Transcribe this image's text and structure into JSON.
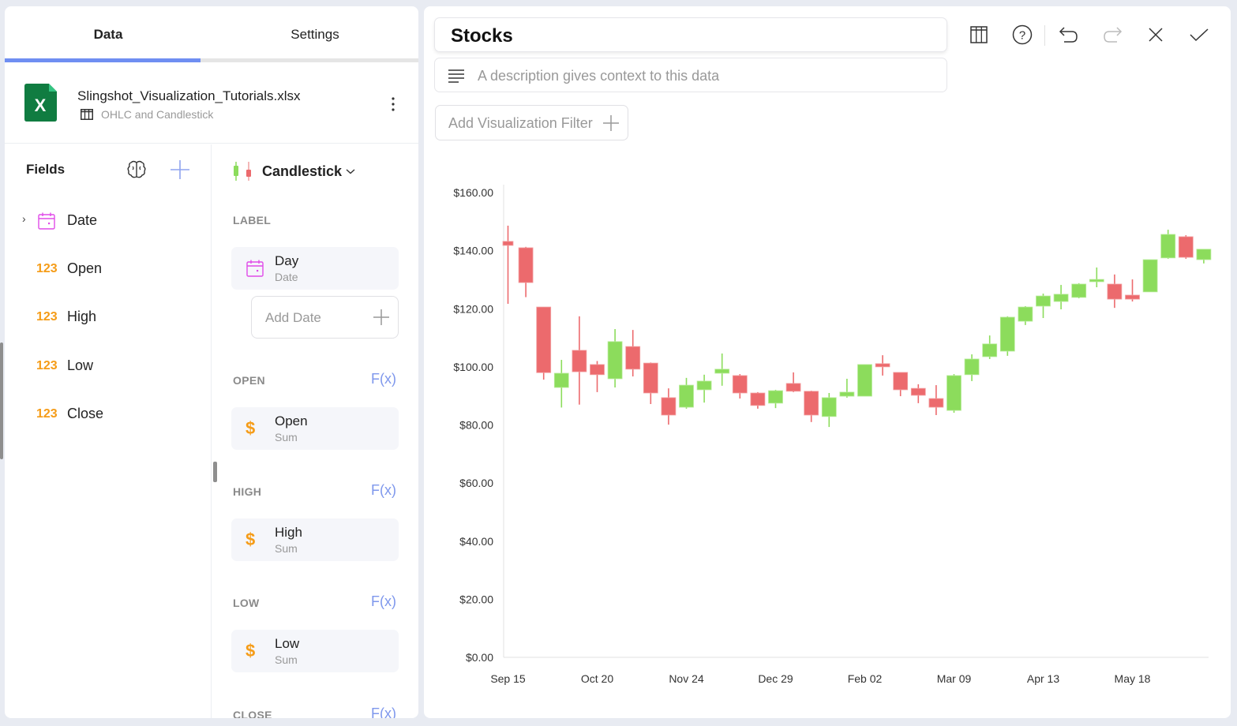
{
  "tabs": [
    {
      "label": "Data",
      "active": true
    },
    {
      "label": "Settings",
      "active": false
    }
  ],
  "source": {
    "file_name": "Slingshot_Visualization_Tutorials.xlsx",
    "sheet_name": "OHLC and Candlestick",
    "file_icon": "excel-icon",
    "menu_icon": "more-vertical-icon"
  },
  "fields": {
    "title": "Fields",
    "items": [
      {
        "label": "Date",
        "type": "date",
        "icon": "calendar-icon",
        "expandable": true
      },
      {
        "label": "Open",
        "type": "number",
        "icon_text": "123"
      },
      {
        "label": "High",
        "type": "number",
        "icon_text": "123"
      },
      {
        "label": "Low",
        "type": "number",
        "icon_text": "123"
      },
      {
        "label": "Close",
        "type": "number",
        "icon_text": "123"
      }
    ]
  },
  "config": {
    "viz_type": "Candlestick",
    "sections": {
      "label": {
        "title": "LABEL",
        "pill_title": "Day",
        "pill_sub": "Date",
        "add_label": "Add Date"
      },
      "open": {
        "title": "OPEN",
        "fx": "F(x)",
        "pill_title": "Open",
        "pill_sub": "Sum",
        "icon_text": "$"
      },
      "high": {
        "title": "HIGH",
        "fx": "F(x)",
        "pill_title": "High",
        "pill_sub": "Sum",
        "icon_text": "$"
      },
      "low": {
        "title": "LOW",
        "fx": "F(x)",
        "pill_title": "Low",
        "pill_sub": "Sum",
        "icon_text": "$"
      },
      "close": {
        "title": "CLOSE",
        "fx": "F(x)"
      }
    }
  },
  "editor": {
    "title": "Stocks",
    "description_placeholder": "A description gives context to this data",
    "filter_label": "Add Visualization Filter"
  },
  "colors": {
    "accent": "#6f8ef2",
    "up": "#8cdc5c",
    "down": "#ec6a6d",
    "number_icon": "#f59c18",
    "date_icon": "#e04ce8"
  },
  "chart_data": {
    "type": "candlestick",
    "title": "Stocks",
    "xlabel": "",
    "ylabel": "",
    "ylim": [
      0,
      160
    ],
    "yticks": [
      "$0.00",
      "$20.00",
      "$40.00",
      "$60.00",
      "$80.00",
      "$100.00",
      "$120.00",
      "$140.00",
      "$160.00"
    ],
    "ytick_values": [
      0,
      20,
      40,
      60,
      80,
      100,
      120,
      140,
      160
    ],
    "xtick_labels": [
      "Sep 15",
      "Oct 20",
      "Nov 24",
      "Dec 29",
      "Feb 02",
      "Mar 09",
      "Apr 13",
      "May 18"
    ],
    "xtick_index": [
      0,
      5,
      10,
      15,
      20,
      25,
      30,
      35
    ],
    "grid": false,
    "candles": [
      {
        "o": 143.2,
        "h": 148.6,
        "l": 121.7,
        "c": 141.8
      },
      {
        "o": 141.0,
        "h": 141.3,
        "l": 124.0,
        "c": 129.0
      },
      {
        "o": 120.6,
        "h": 120.6,
        "l": 95.6,
        "c": 98.0
      },
      {
        "o": 92.9,
        "h": 102.4,
        "l": 86.0,
        "c": 97.8
      },
      {
        "o": 105.7,
        "h": 117.4,
        "l": 87.0,
        "c": 98.3
      },
      {
        "o": 100.8,
        "h": 102.0,
        "l": 91.3,
        "c": 97.3
      },
      {
        "o": 95.9,
        "h": 113.0,
        "l": 92.9,
        "c": 108.7
      },
      {
        "o": 107.0,
        "h": 112.7,
        "l": 96.7,
        "c": 99.2
      },
      {
        "o": 101.3,
        "h": 101.5,
        "l": 87.2,
        "c": 91.0
      },
      {
        "o": 89.4,
        "h": 92.6,
        "l": 80.1,
        "c": 83.4
      },
      {
        "o": 86.1,
        "h": 96.2,
        "l": 85.6,
        "c": 93.7
      },
      {
        "o": 92.1,
        "h": 97.3,
        "l": 87.7,
        "c": 95.1
      },
      {
        "o": 97.8,
        "h": 104.6,
        "l": 93.5,
        "c": 99.2
      },
      {
        "o": 97.0,
        "h": 97.5,
        "l": 89.1,
        "c": 91.0
      },
      {
        "o": 91.0,
        "h": 91.3,
        "l": 85.6,
        "c": 86.7
      },
      {
        "o": 87.5,
        "h": 92.1,
        "l": 85.8,
        "c": 91.8
      },
      {
        "o": 94.3,
        "h": 98.1,
        "l": 91.3,
        "c": 91.6
      },
      {
        "o": 91.6,
        "h": 91.8,
        "l": 81.0,
        "c": 83.4
      },
      {
        "o": 82.9,
        "h": 91.0,
        "l": 79.3,
        "c": 89.4
      },
      {
        "o": 89.9,
        "h": 95.9,
        "l": 89.4,
        "c": 91.3
      },
      {
        "o": 89.9,
        "h": 100.8,
        "l": 89.9,
        "c": 100.8
      },
      {
        "o": 101.1,
        "h": 104.0,
        "l": 97.0,
        "c": 100.0
      },
      {
        "o": 98.1,
        "h": 98.1,
        "l": 89.9,
        "c": 92.1
      },
      {
        "o": 92.6,
        "h": 94.0,
        "l": 87.5,
        "c": 90.2
      },
      {
        "o": 89.1,
        "h": 93.7,
        "l": 83.4,
        "c": 86.1
      },
      {
        "o": 85.0,
        "h": 97.5,
        "l": 84.2,
        "c": 97.0
      },
      {
        "o": 97.3,
        "h": 104.3,
        "l": 95.1,
        "c": 102.7
      },
      {
        "o": 103.5,
        "h": 110.8,
        "l": 102.7,
        "c": 107.9
      },
      {
        "o": 105.4,
        "h": 117.4,
        "l": 103.8,
        "c": 117.1
      },
      {
        "o": 115.7,
        "h": 120.9,
        "l": 114.4,
        "c": 120.6
      },
      {
        "o": 120.9,
        "h": 125.2,
        "l": 116.8,
        "c": 124.4
      },
      {
        "o": 122.5,
        "h": 128.2,
        "l": 119.8,
        "c": 125.0
      },
      {
        "o": 123.9,
        "h": 128.8,
        "l": 123.6,
        "c": 128.5
      },
      {
        "o": 129.3,
        "h": 134.2,
        "l": 127.4,
        "c": 130.1
      },
      {
        "o": 128.5,
        "h": 131.8,
        "l": 120.3,
        "c": 123.3
      },
      {
        "o": 124.7,
        "h": 130.1,
        "l": 122.5,
        "c": 123.3
      },
      {
        "o": 125.8,
        "h": 136.9,
        "l": 125.8,
        "c": 136.9
      },
      {
        "o": 137.5,
        "h": 147.2,
        "l": 137.2,
        "c": 145.6
      },
      {
        "o": 144.8,
        "h": 145.3,
        "l": 137.2,
        "c": 137.7
      },
      {
        "o": 136.9,
        "h": 140.5,
        "l": 135.6,
        "c": 140.5
      }
    ]
  }
}
